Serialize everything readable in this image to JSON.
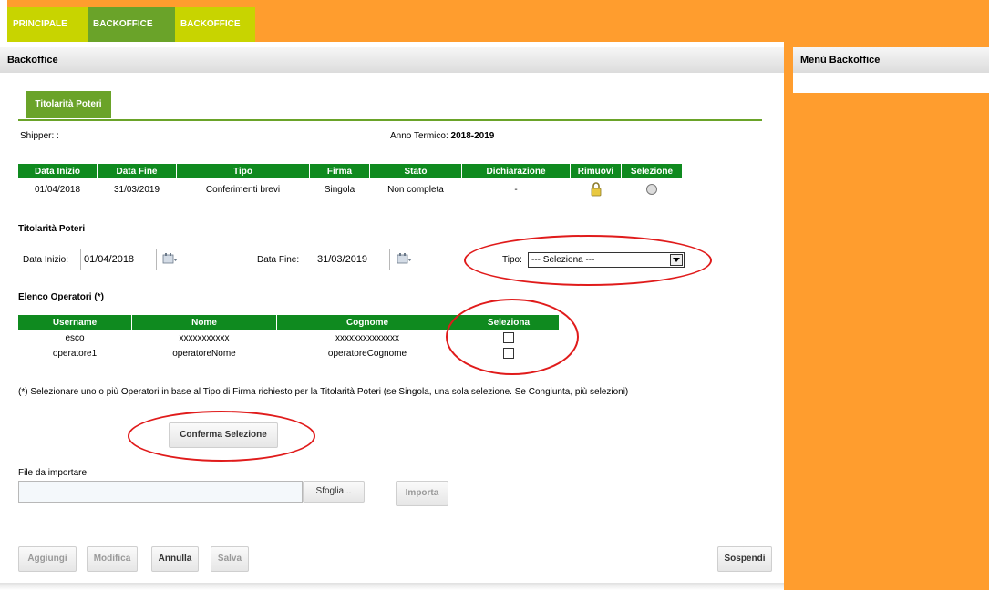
{
  "nav": {
    "tabs": [
      {
        "label": "PRINCIPALE"
      },
      {
        "label": "BACKOFFICE"
      },
      {
        "label": "BACKOFFICE"
      }
    ]
  },
  "main": {
    "title": "Backoffice",
    "tab_label": "Titolarità Poteri",
    "shipper_label": "Shipper: :",
    "anno_label": "Anno Termico:",
    "anno_value": "2018-2019"
  },
  "sidebar": {
    "title": "Menù Backoffice"
  },
  "periods_table": {
    "headers": [
      "Data Inizio",
      "Data Fine",
      "Tipo",
      "Firma",
      "Stato",
      "Dichiarazione",
      "Rimuovi",
      "Selezione"
    ],
    "rows": [
      {
        "data_inizio": "01/04/2018",
        "data_fine": "31/03/2019",
        "tipo": "Conferimenti brevi",
        "firma": "Singola",
        "stato": "Non completa",
        "dichiarazione": "-"
      }
    ]
  },
  "form": {
    "section_title": "Titolarità Poteri",
    "data_inizio_label": "Data Inizio:",
    "data_inizio_value": "01/04/2018",
    "data_fine_label": "Data Fine:",
    "data_fine_value": "31/03/2019",
    "tipo_label": "Tipo:",
    "tipo_selected": "--- Seleziona ---"
  },
  "operators": {
    "section_title": "Elenco Operatori (*)",
    "headers": [
      "Username",
      "Nome",
      "Cognome",
      "Seleziona"
    ],
    "rows": [
      {
        "username": "esco",
        "nome": "xxxxxxxxxxx",
        "cognome": "xxxxxxxxxxxxxx"
      },
      {
        "username": "operatore1",
        "nome": "operatoreNome",
        "cognome": "operatoreCognome"
      }
    ],
    "note": "(*) Selezionare uno o più Operatori in base al Tipo di Firma richiesto per la Titolarità Poteri (se Singola, una sola selezione. Se Congiunta, più selezioni)"
  },
  "buttons": {
    "conferma": "Conferma Selezione",
    "sfoglia": "Sfoglia...",
    "importa": "Importa",
    "aggiungi": "Aggiungi",
    "modifica": "Modifica",
    "annulla": "Annulla",
    "salva": "Salva",
    "sospendi": "Sospendi"
  },
  "file": {
    "label": "File da importare",
    "value": ""
  },
  "colors": {
    "orange": "#ff9d2e",
    "lime": "#c8d400",
    "green": "#6aa329",
    "table_green": "#0f8a1f",
    "highlight_red": "#e01b1b"
  }
}
